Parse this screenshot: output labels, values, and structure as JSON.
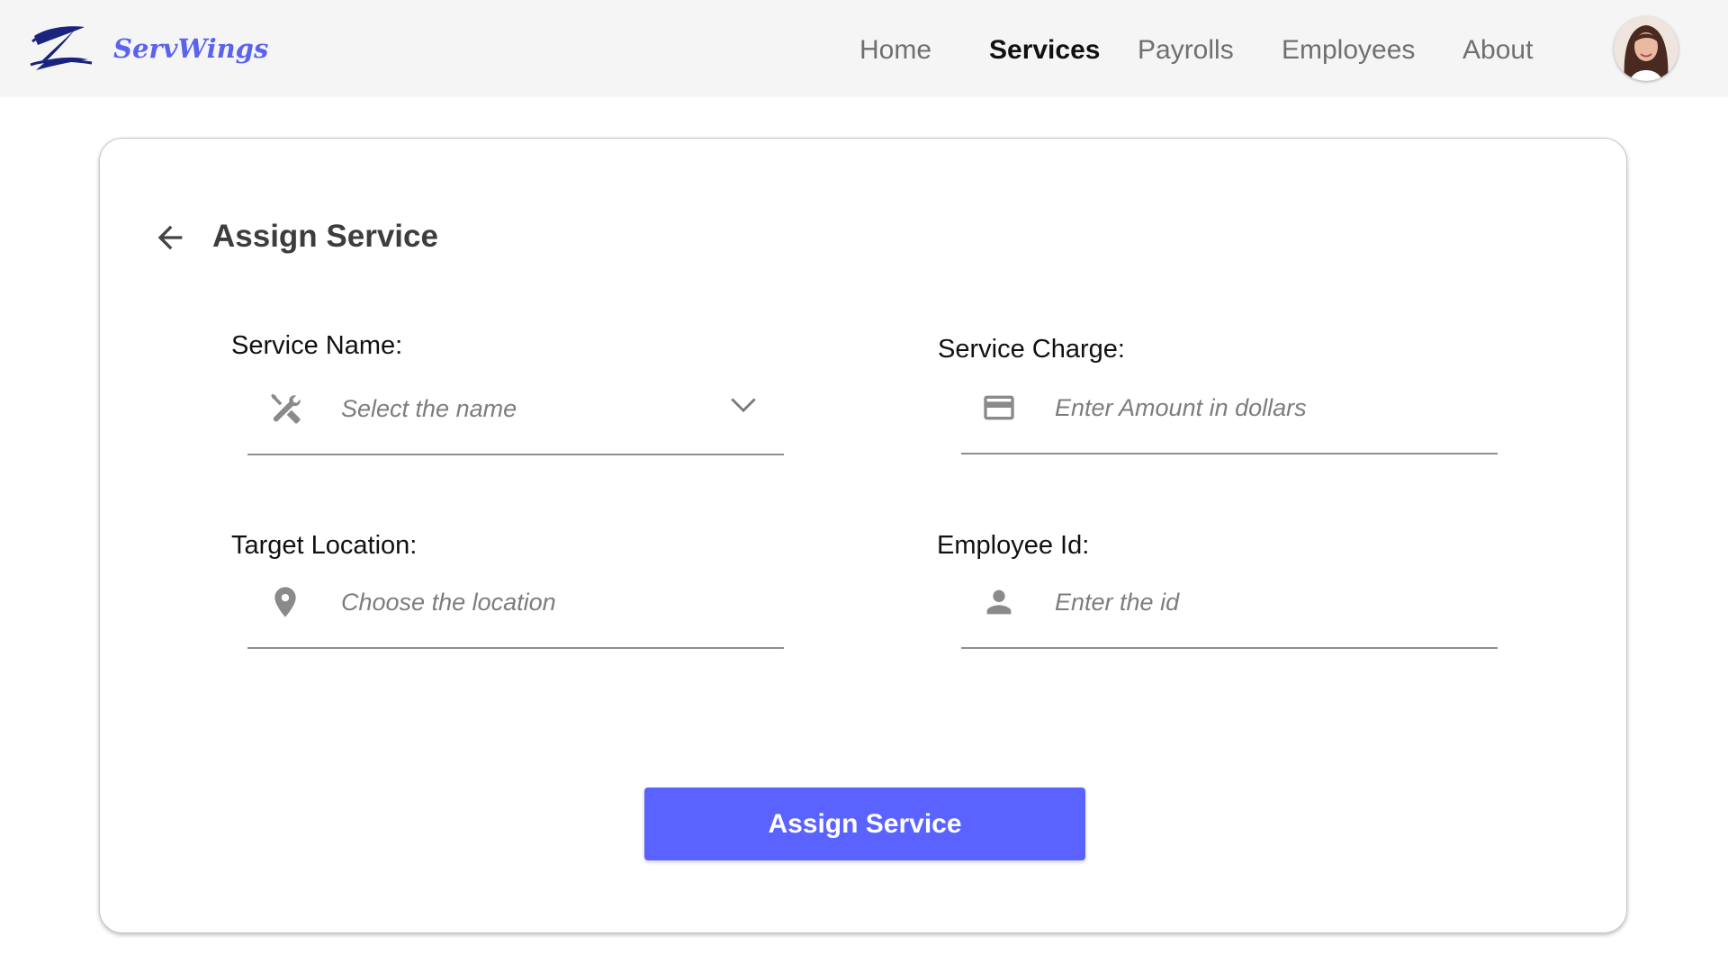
{
  "app": {
    "brand_name": "ServWings"
  },
  "nav": {
    "items": [
      {
        "label": "Home",
        "active": false
      },
      {
        "label": "Services",
        "active": true
      },
      {
        "label": "Payrolls",
        "active": false
      },
      {
        "label": "Employees",
        "active": false
      },
      {
        "label": "About",
        "active": false
      }
    ]
  },
  "page": {
    "title": "Assign Service"
  },
  "form": {
    "service_name": {
      "label": "Service Name:",
      "placeholder": "Select the name",
      "icon": "tools-icon"
    },
    "service_charge": {
      "label": "Service Charge:",
      "placeholder": "Enter Amount in dollars",
      "icon": "credit-card-icon"
    },
    "target_location": {
      "label": "Target Location:",
      "placeholder": "Choose the location",
      "icon": "location-pin-icon"
    },
    "employee_id": {
      "label": "Employee Id:",
      "placeholder": "Enter the id",
      "icon": "person-icon"
    },
    "submit_label": "Assign Service"
  },
  "colors": {
    "accent": "#5a63ff",
    "brand": "#5a63f0",
    "nav_background": "#f5f5f5",
    "logo": "#1a237e"
  }
}
